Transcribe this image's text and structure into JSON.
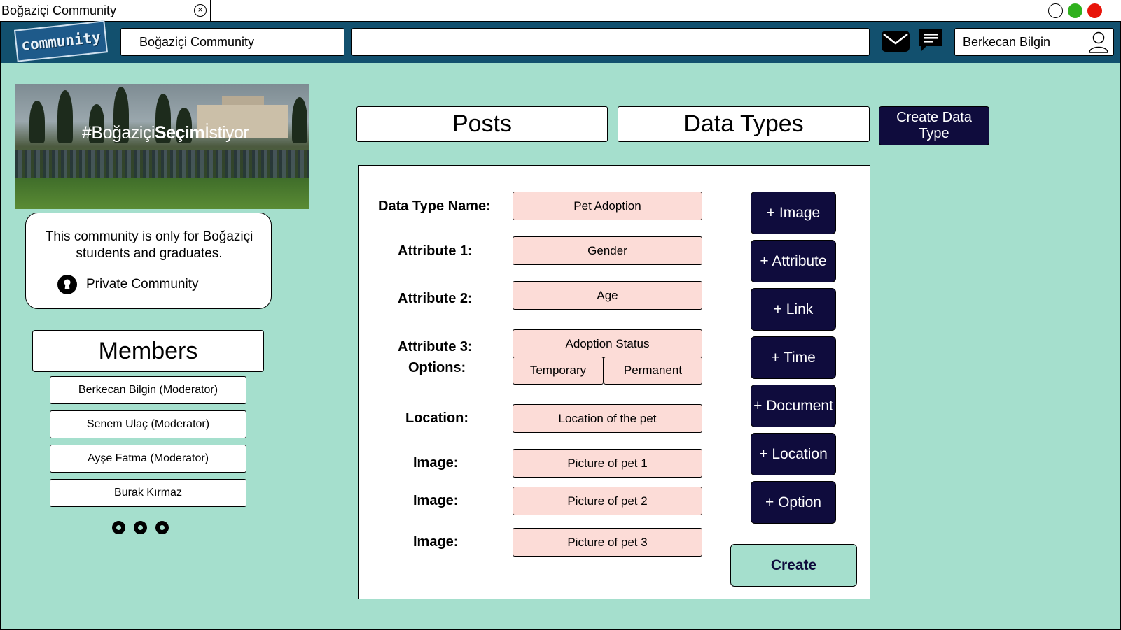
{
  "window": {
    "tab_title": "Boğaziçi Community",
    "close_glyph": "×",
    "controls": [
      {
        "name": "minimize-window-button",
        "color": "#ffffff"
      },
      {
        "name": "maximize-window-button",
        "color": "#2fb11d"
      },
      {
        "name": "close-window-button",
        "color": "#e8140a"
      }
    ]
  },
  "nav": {
    "logo_text": "community",
    "community_field": "Boğaziçi Community",
    "search_value": "",
    "icons": [
      "mail-icon",
      "chat-icon",
      "user-icon"
    ],
    "user_name": "Berkecan Bilgin"
  },
  "sidebar": {
    "banner_prefix": "#Boğaziçi",
    "banner_bold": "Seçim",
    "banner_suffix": "İstiyor",
    "info_text": "This community is only for Boğaziçi stuıdents and graduates.",
    "privacy_label": "Private Community",
    "members_title": "Members",
    "members": [
      "Berkecan Bilgin (Moderator)",
      "Senem Ulaç (Moderator)",
      "Ayşe Fatma (Moderator)",
      "Burak Kırmaz"
    ]
  },
  "tabs": {
    "posts": "Posts",
    "data_types": "Data Types",
    "create_data_type": "Create Data Type"
  },
  "form": {
    "labels": {
      "name": "Data Type Name:",
      "attr1": "Attribute 1:",
      "attr2": "Attribute 2:",
      "attr3": "Attribute 3:",
      "options": "Options:",
      "location": "Location:",
      "image1": "Image:",
      "image2": "Image:",
      "image3": "Image:"
    },
    "values": {
      "name": "Pet Adoption",
      "attr1": "Gender",
      "attr2": "Age",
      "attr3": "Adoption Status",
      "option1": "Temporary",
      "option2": "Permanent",
      "location": "Location of the pet",
      "image1": "Picture of pet 1",
      "image2": "Picture of pet 2",
      "image3": "Picture of pet 3"
    },
    "add_buttons": [
      "+ Image",
      "+ Attribute",
      "+ Link",
      "+ Time",
      "+ Document",
      "+ Location",
      "+ Option"
    ],
    "create": "Create"
  }
}
